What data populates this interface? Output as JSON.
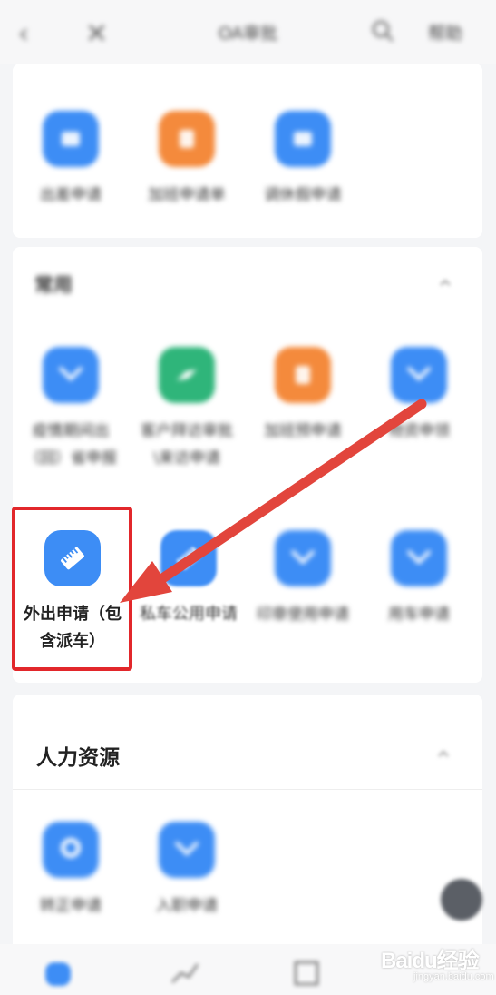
{
  "header": {
    "title": "OA审批",
    "more_label": "帮助"
  },
  "section_top": {
    "apps": [
      {
        "label": "出差申请",
        "color": "#3d8df5"
      },
      {
        "label": "加班申请单",
        "color": "#f48a3c"
      },
      {
        "label": "调休假申请",
        "color": "#3d8df5"
      }
    ]
  },
  "section_favorites": {
    "title": "常用",
    "apps": [
      {
        "label": "疫情期间出（回）省申报",
        "color": "#3d8df5"
      },
      {
        "label": "客户拜访审批\\来访申请",
        "color": "#2fb57a"
      },
      {
        "label": "加班预申请",
        "color": "#f48a3c"
      },
      {
        "label": "物资申领",
        "color": "#3d8df5"
      },
      {
        "label": "外出申请（包含派车）",
        "color": "#3d8df5"
      },
      {
        "label": "私车公用申请",
        "color": "#3d8df5"
      },
      {
        "label": "印章使用申请",
        "color": "#3d8df5"
      },
      {
        "label": "用车申请",
        "color": "#3d8df5"
      }
    ]
  },
  "section_hr": {
    "title": "人力资源",
    "apps": [
      {
        "label": "转正申请",
        "color": "#3d8df5"
      },
      {
        "label": "入职申请",
        "color": "#3d8df5"
      }
    ]
  },
  "watermark": {
    "main": "Baidu经验",
    "sub": "jingyan.baidu.com"
  },
  "colors": {
    "accent_blue": "#3d8df5",
    "highlight_red": "#e2272b"
  }
}
